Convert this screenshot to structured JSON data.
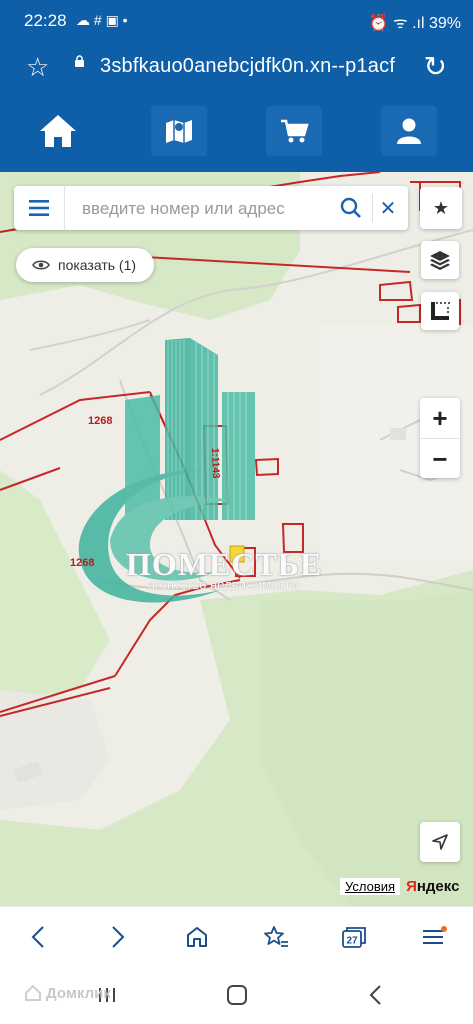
{
  "status_bar": {
    "time": "22:28",
    "icons": "☁ # ▣ •",
    "right": "⏰ ᯤ .ıl 39%"
  },
  "browser": {
    "url": "3sbfkauo0anebcjdfk0n.xn--p1acf"
  },
  "site_nav": {
    "items": [
      {
        "name": "home-icon"
      },
      {
        "name": "map-icon"
      },
      {
        "name": "cart-icon"
      },
      {
        "name": "user-icon"
      }
    ]
  },
  "search": {
    "placeholder": "введите номер или адрес"
  },
  "show_button": {
    "label": "показать (1)"
  },
  "map": {
    "parcel_labels": [
      "1268",
      "1268"
    ],
    "parcel_number": "1143",
    "parcel_number_prefix": "1:"
  },
  "watermark": {
    "name": "ПОМЕСТЬЕ",
    "subtitle": "агентство недвижимости"
  },
  "attribution": {
    "terms": "Условия",
    "yandex_ya": "Я",
    "yandex_rest": "ндекс"
  },
  "browser_bottom": {
    "tabs_count": "27"
  },
  "system_watermark": {
    "text": "Домклик"
  },
  "colors": {
    "brand_blue": "#0f5ea8",
    "parcel_red": "#c62828",
    "map_green": "#d6e8c6",
    "watermark_teal": "#3db39e"
  }
}
